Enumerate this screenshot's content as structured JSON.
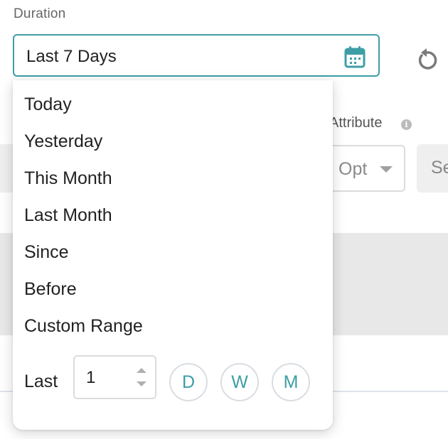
{
  "duration": {
    "label": "Duration",
    "value": "Last 7 Days",
    "icon": "calendar-icon",
    "accent_color": "#3d9ea6"
  },
  "reset": {
    "icon": "reset-icon"
  },
  "background": {
    "attribute_label": "Attribute",
    "info_icon": "i",
    "opt_select_text": "Opt",
    "se_button_text": "Se"
  },
  "dropdown": {
    "items": [
      {
        "label": "Today"
      },
      {
        "label": "Yesterday"
      },
      {
        "label": "This Month"
      },
      {
        "label": "Last Month"
      },
      {
        "label": "Since"
      },
      {
        "label": "Before"
      },
      {
        "label": "Custom Range"
      }
    ],
    "last": {
      "label": "Last",
      "value": "1",
      "units": [
        "D",
        "W",
        "M"
      ]
    }
  }
}
